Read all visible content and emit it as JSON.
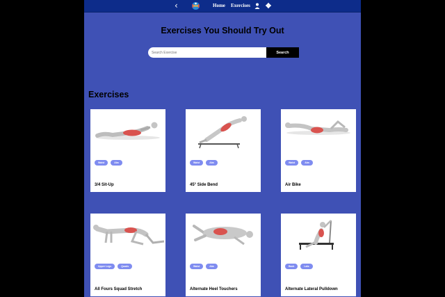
{
  "nav": {
    "back_icon": "chevron-left-icon",
    "logo_icon": "gym-logo-icon",
    "home": "Home",
    "exercises": "Exercises",
    "user_icon": "user-icon",
    "settings_icon": "gear-icon"
  },
  "hero": {
    "title": "Exercises You Should Try Out",
    "search_placeholder": "Search Exercise",
    "search_button": "Search"
  },
  "section": {
    "title": "Exercises"
  },
  "exercises": [
    {
      "name": "3/4 Sit-Up",
      "tags": [
        "Waist",
        "Abs"
      ]
    },
    {
      "name": "45° Side Bend",
      "tags": [
        "Waist",
        "Abs"
      ]
    },
    {
      "name": "Air Bike",
      "tags": [
        "Waist",
        "Abs"
      ]
    },
    {
      "name": "All Fours Squad Stretch",
      "tags": [
        "Upper Legs",
        "Quads"
      ]
    },
    {
      "name": "Alternate Heel Touchers",
      "tags": [
        "Waist",
        "Abs"
      ]
    },
    {
      "name": "Alternate Lateral Pulldown",
      "tags": [
        "Back",
        "Lats"
      ]
    }
  ],
  "colors": {
    "page_bg": "#3f51b5",
    "nav_bg": "#0d2c8a",
    "chip_bg": "#7f8cf0",
    "card_bg": "#ffffff",
    "muscle_highlight": "#d9534f"
  }
}
